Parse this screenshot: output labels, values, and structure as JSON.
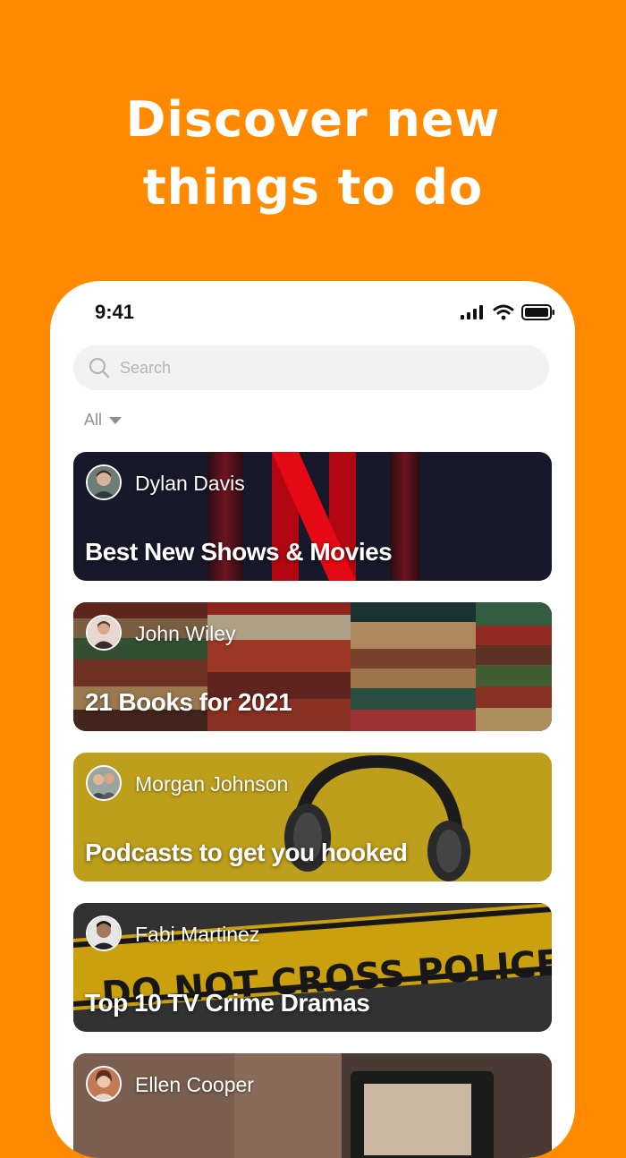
{
  "headline": {
    "line1": "Discover new",
    "line2": "things to do"
  },
  "status_bar": {
    "time": "9:41"
  },
  "search": {
    "placeholder": "Search"
  },
  "filter": {
    "label": "All"
  },
  "cards": [
    {
      "author": "Dylan Davis",
      "title": "Best New Shows & Movies"
    },
    {
      "author": "John Wiley",
      "title": "21 Books for 2021"
    },
    {
      "author": "Morgan Johnson",
      "title": "Podcasts to get you hooked"
    },
    {
      "author": "Fabi Martinez",
      "title": "Top 10 TV Crime Dramas"
    },
    {
      "author": "Ellen Cooper",
      "title": ""
    }
  ],
  "colors": {
    "background": "#FF8A00",
    "phone": "#FFFFFF",
    "search_bg": "#F2F2F2"
  }
}
